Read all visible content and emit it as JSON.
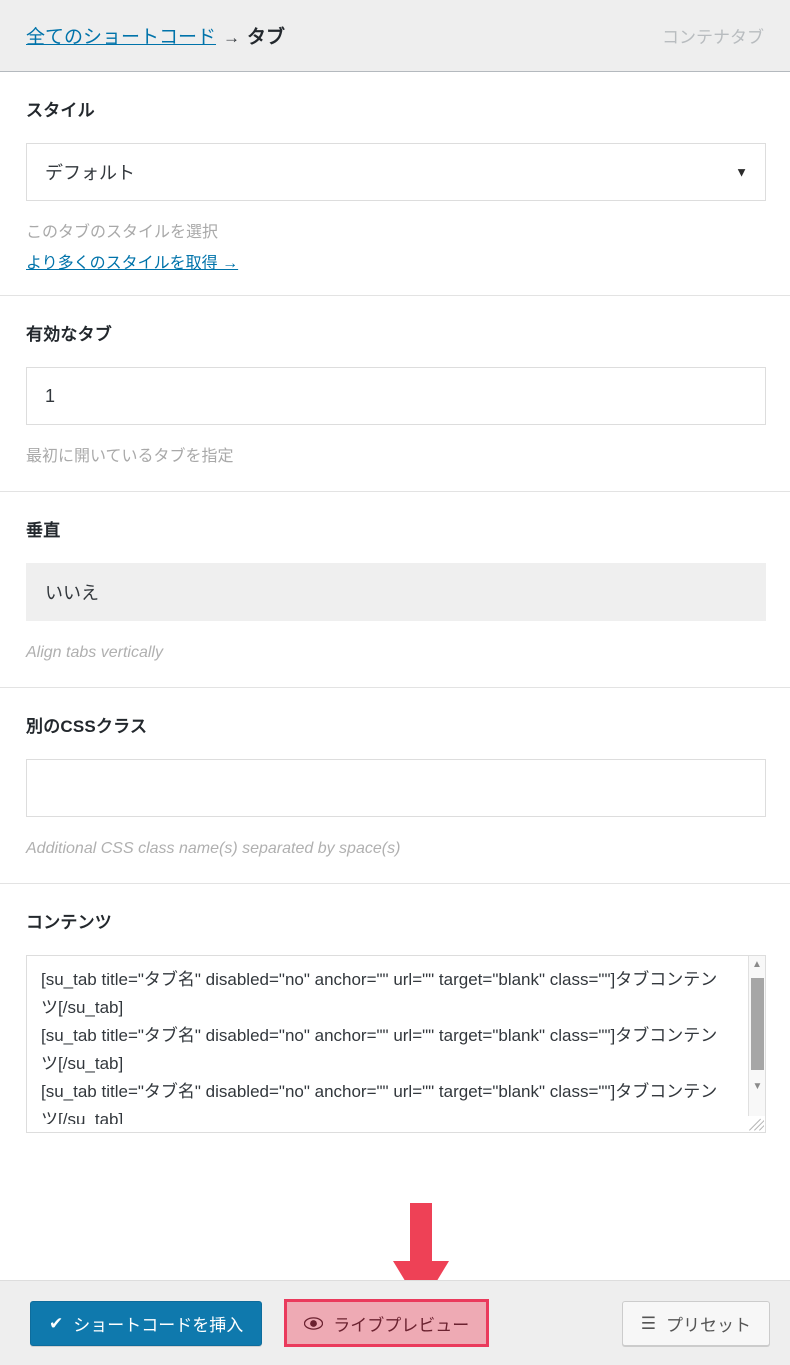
{
  "header": {
    "breadcrumb_link": "全てのショートコード",
    "breadcrumb_separator": "→",
    "breadcrumb_current": "タブ",
    "context_label": "コンテナタブ"
  },
  "fields": [
    {
      "label": "スタイル",
      "control_type": "select",
      "value": "デフォルト",
      "arrow_glyph": "▼",
      "help": "このタブのスタイルを選択",
      "help_link": "より多くのスタイルを取得 →"
    },
    {
      "label": "有効なタブ",
      "control_type": "text",
      "value": "1",
      "help": "最初に開いているタブを指定"
    },
    {
      "label": "垂直",
      "control_type": "select-disabled",
      "value": "いいえ",
      "help": "Align tabs vertically"
    },
    {
      "label": "別のCSSクラス",
      "control_type": "text",
      "value": "",
      "placeholder": "",
      "help": "Additional CSS class name(s) separated by space(s)"
    }
  ],
  "content": {
    "label": "コンテンツ",
    "value": "[su_tab title=\"タブ名\" disabled=\"no\" anchor=\"\" url=\"\" target=\"blank\" class=\"\"]タブコンテンツ[/su_tab]\n[su_tab title=\"タブ名\" disabled=\"no\" anchor=\"\" url=\"\" target=\"blank\" class=\"\"]タブコンテンツ[/su_tab]\n[su_tab title=\"タブ名\" disabled=\"no\" anchor=\"\" url=\"\" target=\"blank\" class=\"\"]タブコンテンツ[/su_tab]",
    "scroll_up_glyph": "▲",
    "scroll_down_glyph": "▼"
  },
  "footer": {
    "insert_icon": "✔",
    "insert_label": "ショートコードを挿入",
    "preview_icon": "eye-icon",
    "preview_label": "ライブプレビュー",
    "preset_icon": "☰",
    "preset_label": "プリセット"
  },
  "colors": {
    "accent_blue": "#0f79ad",
    "link_blue": "#0073aa",
    "highlight_border": "#ea3a5c",
    "highlight_fill": "#eeaab4",
    "annotation_arrow": "#ee4156",
    "header_bg": "#eeeeee"
  }
}
